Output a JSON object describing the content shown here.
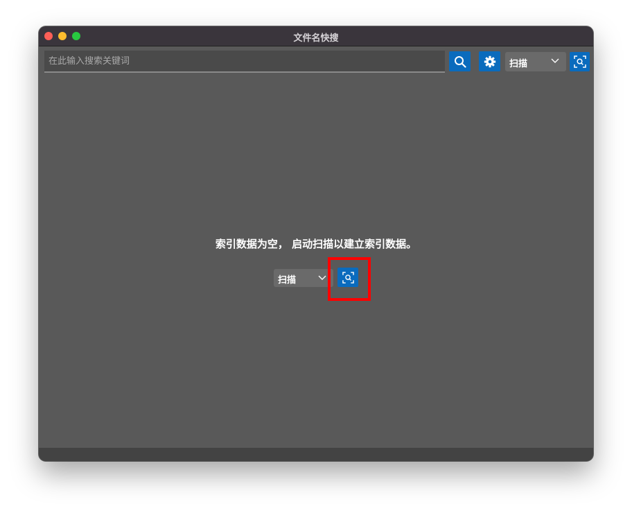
{
  "window": {
    "title": "文件名快搜"
  },
  "toolbar": {
    "search_placeholder": "在此输入搜索关键词",
    "search_icon": "search-icon",
    "settings_icon": "gear-icon",
    "scan_select_value": "扫描",
    "scan_action_icon": "scan-icon"
  },
  "main": {
    "empty_message": "索引数据为空， 启动扫描以建立索引数据。",
    "scan_select_value": "扫描",
    "scan_action_icon": "scan-icon"
  },
  "colors": {
    "accent": "#0a6bbd",
    "highlight": "#ff0000",
    "window_bg": "#595959",
    "titlebar_bg": "#3a353c"
  }
}
